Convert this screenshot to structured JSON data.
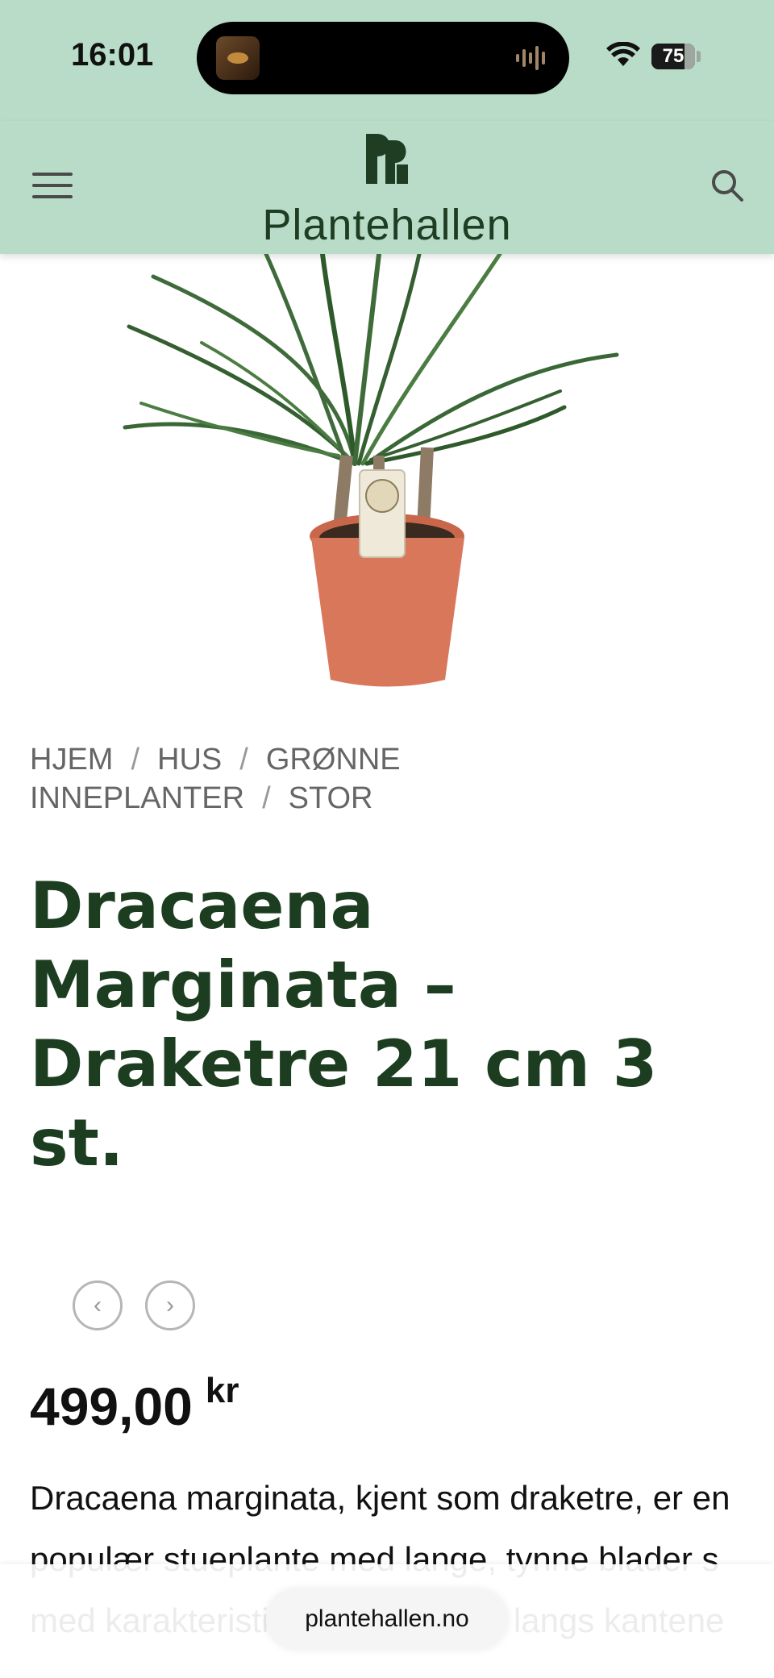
{
  "status_bar": {
    "time": "16:01",
    "battery_level": "75",
    "battery_fraction": 0.75
  },
  "header": {
    "logo_text": "Plantehallen",
    "menu_icon": "hamburger-menu-icon",
    "search_icon": "search-icon"
  },
  "breadcrumb": {
    "items": [
      "HJEM",
      "HUS",
      "GRØNNE INNEPLANTER",
      "STOR"
    ],
    "separator": "/"
  },
  "product": {
    "title": "Dracaena Marginata – Draketre 21 cm 3 st.",
    "price": "499,00",
    "currency": "kr",
    "description": "Dracaena marginata, kjent som draketre, er en populær stueplante med lange, tynne blader s med karakteristiske røde kanter langs kantene"
  },
  "gallery_nav": {
    "prev": "‹",
    "next": "›"
  },
  "browser": {
    "url": "plantehallen.no"
  },
  "colors": {
    "header_bg": "#b8dcc8",
    "brand_green": "#1c3d1f"
  }
}
